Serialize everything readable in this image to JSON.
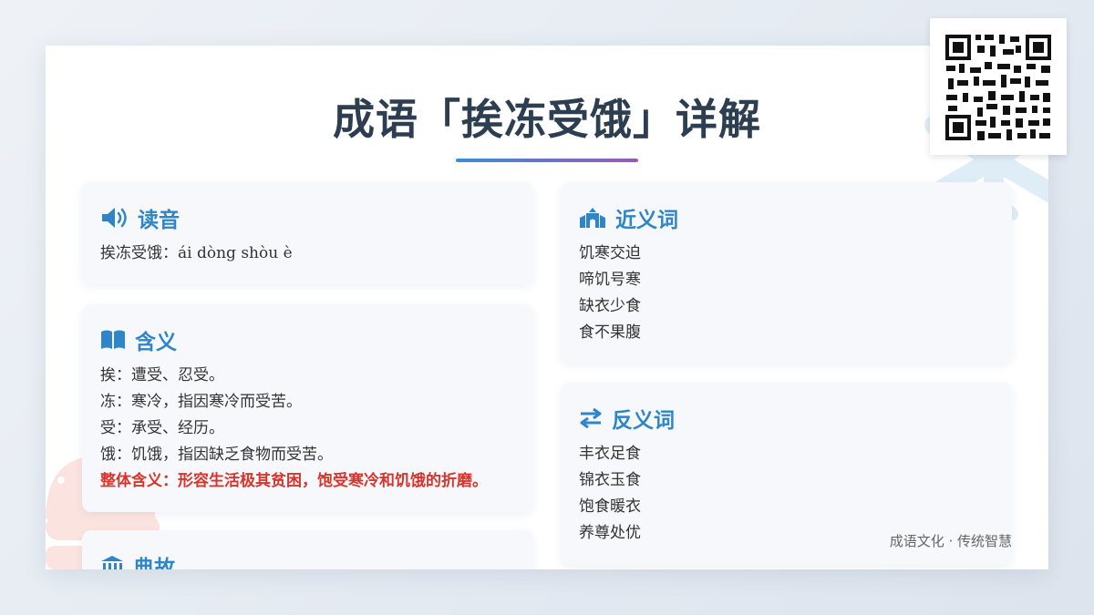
{
  "title": "成语「挨冻受饿」详解",
  "pronunciation": {
    "heading": "读音",
    "icon": "speaker-icon",
    "text": "挨冻受饿：ái dòng shòu è"
  },
  "meaning": {
    "heading": "含义",
    "icon": "open-book-icon",
    "lines": [
      "挨：遭受、忍受。",
      "冻：寒冷，指因寒冷而受苦。",
      "受：承受、经历。",
      "饿：饥饿，指因缺乏食物而受苦。"
    ],
    "summary": "整体含义：形容生活极其贫困，饱受寒冷和饥饿的折磨。"
  },
  "story": {
    "heading": "典故",
    "icon": "classical-building-icon"
  },
  "synonyms": {
    "heading": "近义词",
    "icon": "temple-icon",
    "items": [
      "饥寒交迫",
      "啼饥号寒",
      "缺衣少食",
      "食不果腹"
    ]
  },
  "antonyms": {
    "heading": "反义词",
    "icon": "swap-arrows-icon",
    "items": [
      "丰衣足食",
      "锦衣玉食",
      "饱食暖衣",
      "养尊处优"
    ]
  },
  "footer": "成语文化 · 传统智慧",
  "colors": {
    "accent": "#2e86c9",
    "highlight": "#d9342b",
    "title": "#2c3e50",
    "card_bg": "#f6f8fb"
  }
}
